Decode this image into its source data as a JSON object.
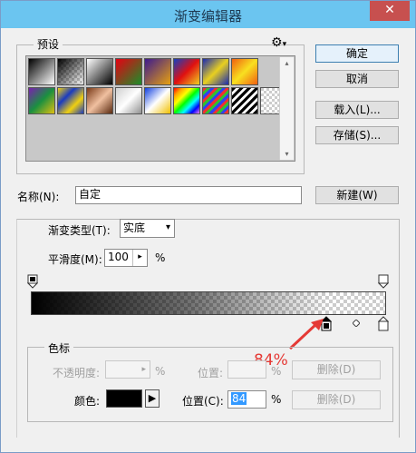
{
  "window": {
    "title": "渐变编辑器",
    "close_glyph": "✕"
  },
  "presets": {
    "label": "预设",
    "gear_glyph": "⚙",
    "gear_caret": "▾",
    "scroll_up_glyph": "▴",
    "scroll_down_glyph": "▾"
  },
  "buttons": {
    "ok": "确定",
    "cancel": "取消",
    "load": "载入(L)...",
    "save": "存储(S)...",
    "new": "新建(W)"
  },
  "name": {
    "label": "名称(N):",
    "value": "自定"
  },
  "gradient": {
    "type_label": "渐变类型(T):",
    "type_value": "实底",
    "type_caret": "▾",
    "smoothness_label": "平滑度(M):",
    "smoothness_value": "100",
    "smoothness_arrow": "▸",
    "smoothness_unit": "%"
  },
  "color_stops": {
    "group_label": "色标",
    "opacity_label": "不透明度:",
    "opacity_value": "",
    "opacity_unit": "%",
    "opacity_location_label": "位置:",
    "opacity_location_value": "",
    "opacity_location_unit": "%",
    "opacity_delete": "删除(D)",
    "color_label": "颜色:",
    "color_value": "#000000",
    "color_arrow": "▶",
    "location_label": "位置(C):",
    "location_value": "84",
    "location_unit": "%",
    "color_delete": "删除(D)",
    "selected_stop_location": 84
  },
  "annotation": {
    "text": "84%",
    "color": "#e53935"
  },
  "colors": {
    "titlebar": "#6bc5f0",
    "close": "#c7504f",
    "selection": "#3399ff",
    "annotation": "#e53935"
  }
}
